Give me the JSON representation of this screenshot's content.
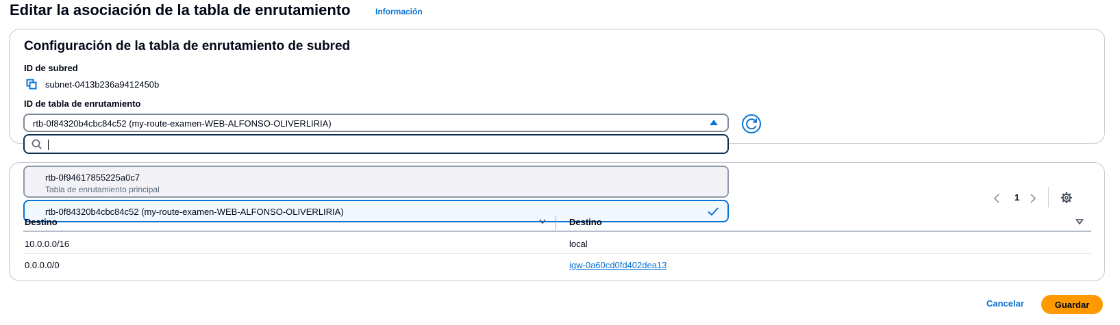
{
  "header": {
    "title": "Editar la asociación de la tabla de enrutamiento",
    "info_link": "Información"
  },
  "config": {
    "section_title": "Configuración de la tabla de enrutamiento de subred",
    "subnet_label": "ID de subred",
    "subnet_id": "subnet-0413b236a9412450b",
    "route_table_label": "ID de tabla de enrutamiento",
    "selected_route_table": "rtb-0f84320b4cbc84c52 (my-route-examen-WEB-ALFONSO-OLIVERLIRIA)"
  },
  "dropdown": {
    "search_value": "",
    "options": [
      {
        "label": "rtb-0f94617855225a0c7",
        "description": "Tabla de enrutamiento principal"
      },
      {
        "label": "rtb-0f84320b4cbc84c52 (my-route-examen-WEB-ALFONSO-OLIVERLIRIA)",
        "description": ""
      }
    ]
  },
  "routes": {
    "pagination_page": "1",
    "columns": [
      "Destino",
      "Destino"
    ],
    "rows": [
      {
        "destination": "10.0.0.0/16",
        "target": "local"
      },
      {
        "destination": "0.0.0.0/0",
        "target": "igw-0a60cd0fd402dea13"
      }
    ]
  },
  "actions": {
    "cancel_label": "Cancelar",
    "save_label": "Guardar"
  },
  "colors": {
    "accent": "#0972d3",
    "primary_button": "#ff9900",
    "text": "#000716"
  }
}
